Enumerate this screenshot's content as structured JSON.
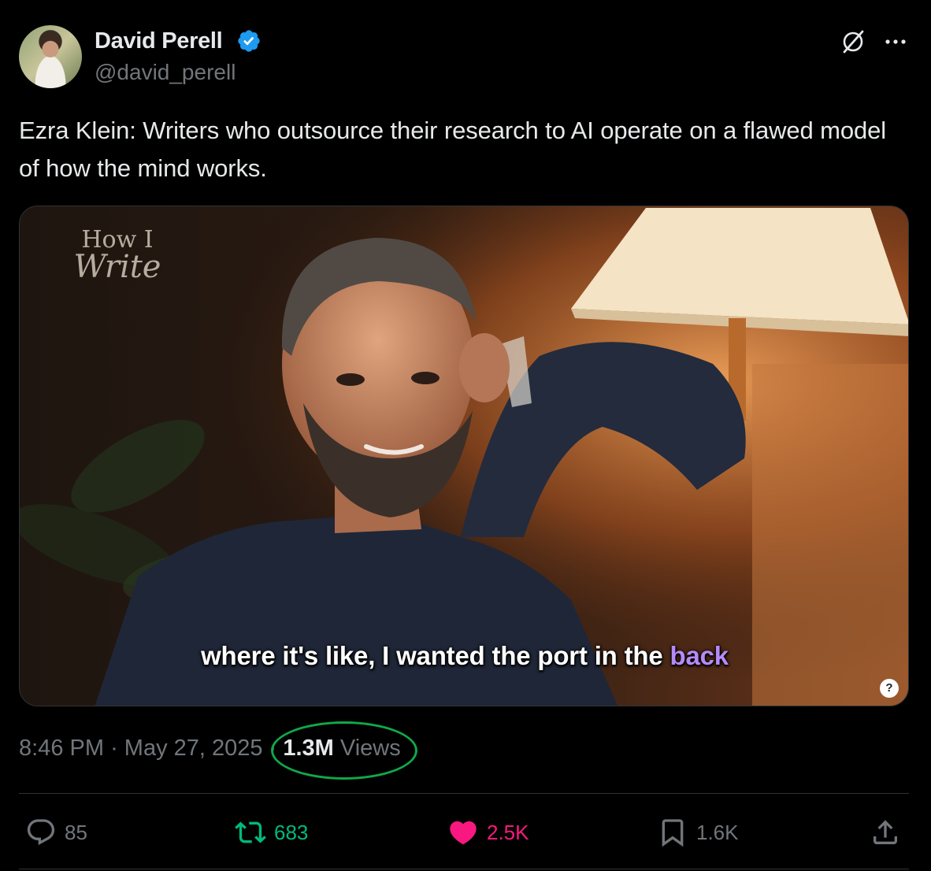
{
  "author": {
    "display_name": "David Perell",
    "handle": "@david_perell",
    "verified": true
  },
  "tweet": {
    "text": "Ezra Klein: Writers who outsource their research to AI operate on a flawed model of how the mind works."
  },
  "media": {
    "watermark_top": "How I",
    "watermark_bottom": "Write",
    "caption_main": "where it's like, I wanted the port in the ",
    "caption_highlight": "back",
    "info_badge": "?"
  },
  "meta": {
    "time": "8:46 PM",
    "separator": "·",
    "date": "May 27, 2025",
    "views_count": "1.3M",
    "views_label": "Views"
  },
  "actions": {
    "replies": "85",
    "reposts": "683",
    "likes": "2.5K",
    "bookmarks": "1.6K"
  },
  "colors": {
    "background": "#000000",
    "text_primary": "#e7e9ea",
    "text_secondary": "#71767b",
    "verified_blue": "#1d9bf0",
    "repost_green": "#00ba7c",
    "like_pink": "#f91880",
    "annotation_ring": "#0fa84a",
    "caption_highlight": "#b58af7"
  },
  "icons": {
    "verified": "verified-badge-icon",
    "grok": "grok-icon",
    "more": "more-horizontal-icon",
    "reply": "reply-icon",
    "repost": "repost-icon",
    "like": "heart-filled-icon",
    "bookmark": "bookmark-icon",
    "share": "share-icon"
  }
}
